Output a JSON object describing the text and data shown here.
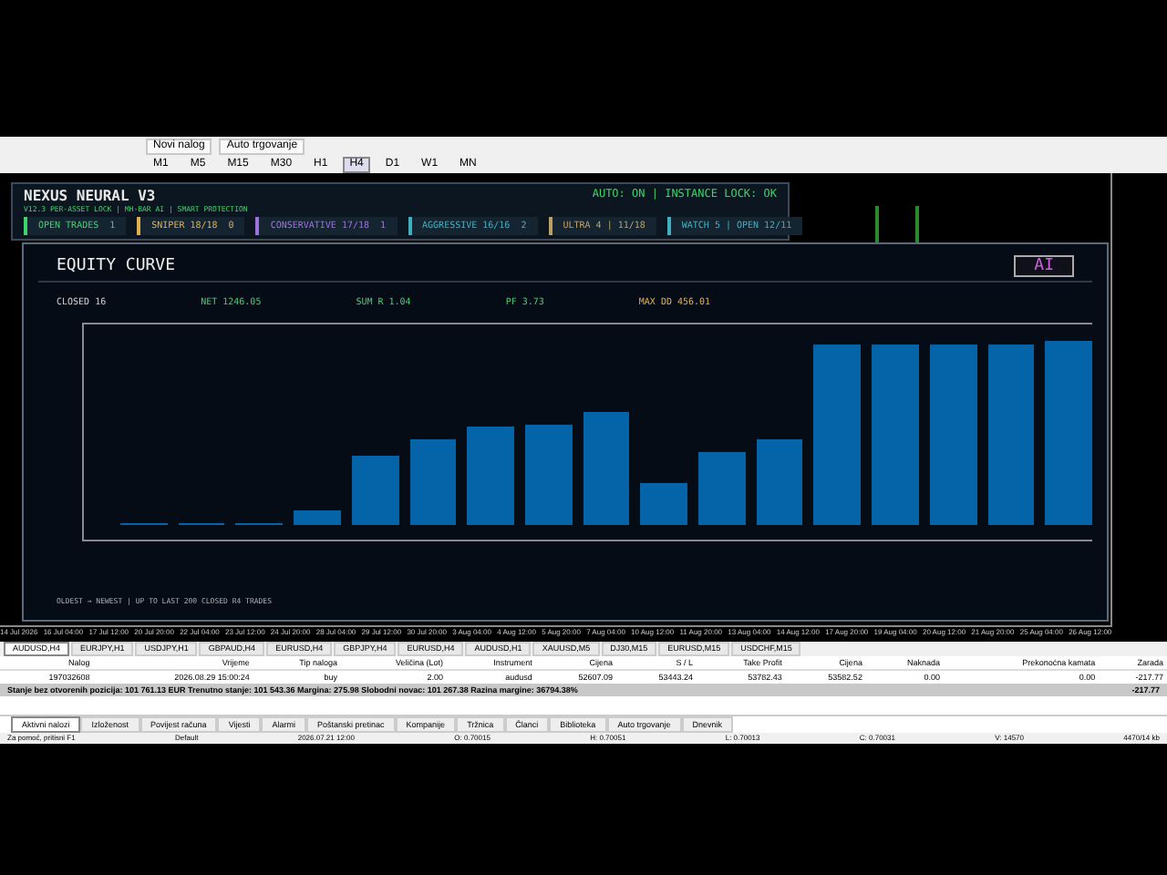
{
  "toolbar": {
    "buttons": [
      {
        "label": "Novi nalog"
      },
      {
        "label": "Auto trgovanje"
      }
    ],
    "timeframes": [
      {
        "label": "M1",
        "selected": false
      },
      {
        "label": "M5",
        "selected": false
      },
      {
        "label": "M15",
        "selected": false
      },
      {
        "label": "M30",
        "selected": false
      },
      {
        "label": "H1",
        "selected": false
      },
      {
        "label": "H4",
        "selected": true
      },
      {
        "label": "D1",
        "selected": false
      },
      {
        "label": "W1",
        "selected": false
      },
      {
        "label": "MN",
        "selected": false
      }
    ]
  },
  "dashboard": {
    "title": "NEXUS NEURAL V3",
    "subtitle": "V12.3 PER-ASSET LOCK | MH-BAR AI | SMART PROTECTION",
    "status": "AUTO: ON | INSTANCE LOCK: OK",
    "chips": [
      {
        "label": "OPEN TRADES",
        "value": "1",
        "color": "#3fd36a"
      },
      {
        "label": "SNIPER 18/18",
        "value": "0",
        "color": "#e0b050"
      },
      {
        "label": "CONSERVATIVE 17/18",
        "value": "1",
        "color": "#a070e0"
      },
      {
        "label": "AGGRESSIVE 16/16",
        "value": "2",
        "color": "#40b0c0"
      },
      {
        "label": "ULTRA 4 | 11/18",
        "color": "#c0a060"
      },
      {
        "label": "WATCH 5 | OPEN 12/11",
        "color": "#40b0c0"
      }
    ]
  },
  "equity": {
    "title": "EQUITY CURVE",
    "ai_button": "AI",
    "stats": [
      {
        "text": "CLOSED 16",
        "color": "#d0d0d0"
      },
      {
        "text": "NET 1246.05",
        "color": "#3fd36a"
      },
      {
        "text": "SUM R 1.04",
        "color": "#3fd36a"
      },
      {
        "text": "PF 3.73",
        "color": "#3fd36a"
      },
      {
        "text": "MAX DD 456.01",
        "color": "#e0b050"
      }
    ],
    "footer": "OLDEST → NEWEST | UP TO LAST 200 CLOSED R4 TRADES"
  },
  "time_axis": [
    "14 Jul 2026",
    "16 Jul 04:00",
    "17 Jul 12:00",
    "20 Jul 20:00",
    "22 Jul 04:00",
    "23 Jul 12:00",
    "24 Jul 20:00",
    "28 Jul 04:00",
    "29 Jul 12:00",
    "30 Jul 20:00",
    "3 Aug 04:00",
    "4 Aug 12:00",
    "5 Aug 20:00",
    "7 Aug 04:00",
    "10 Aug 12:00",
    "11 Aug 20:00",
    "13 Aug 04:00",
    "14 Aug 12:00",
    "17 Aug 20:00",
    "19 Aug 04:00",
    "20 Aug 12:00",
    "21 Aug 20:00",
    "25 Aug 04:00",
    "26 Aug 12:00"
  ],
  "chart_tabs": [
    {
      "label": "AUDUSD,H4",
      "selected": true
    },
    {
      "label": "EURJPY,H1",
      "selected": false
    },
    {
      "label": "USDJPY,H1",
      "selected": false
    },
    {
      "label": "GBPAUD,H4",
      "selected": false
    },
    {
      "label": "EURUSD,H4",
      "selected": false
    },
    {
      "label": "GBPJPY,H4",
      "selected": false
    },
    {
      "label": "EURUSD,H4",
      "selected": false
    },
    {
      "label": "AUDUSD,H1",
      "selected": false
    },
    {
      "label": "XAUUSD,M5",
      "selected": false
    },
    {
      "label": "DJ30,M15",
      "selected": false
    },
    {
      "label": "EURUSD,M15",
      "selected": false
    },
    {
      "label": "USDCHF,M15",
      "selected": false
    }
  ],
  "orders": {
    "columns": [
      "Nalog",
      "Vrijeme",
      "Tip naloga",
      "Veličina (Lot)",
      "Instrument",
      "Cijena",
      "S / L",
      "Take Profit",
      "Cijena",
      "Naknada",
      "Prekonoćna kamata",
      "Zarada"
    ],
    "rows": [
      [
        "197032608",
        "2026.08.29 15:00:24",
        "buy",
        "2.00",
        "audusd",
        "52607.09",
        "53443.24",
        "53782.43",
        "53582.52",
        "0.00",
        "0.00",
        "-217.77"
      ]
    ],
    "summary": "Stanje bez otvorenih pozicija: 101 761.13 EUR  Trenutno stanje: 101 543.36  Margina: 275.98  Slobodni novac: 101 267.38  Razina margine: 36794.38%",
    "summary_total": "-217.77"
  },
  "terminal_tabs": [
    {
      "label": "Aktivni nalozi",
      "selected": true
    },
    {
      "label": "Izloženost",
      "selected": false
    },
    {
      "label": "Povijest računa",
      "selected": false
    },
    {
      "label": "Vijesti",
      "selected": false
    },
    {
      "label": "Alarmi",
      "selected": false
    },
    {
      "label": "Poštanski pretinac",
      "selected": false
    },
    {
      "label": "Kompanije",
      "selected": false
    },
    {
      "label": "Tržnica",
      "selected": false
    },
    {
      "label": "Članci",
      "selected": false
    },
    {
      "label": "Biblioteka",
      "selected": false
    },
    {
      "label": "Auto trgovanje",
      "selected": false
    },
    {
      "label": "Dnevnik",
      "selected": false
    }
  ],
  "status_bar": {
    "help": "Za pomoć, pritisni F1",
    "profile": "Default",
    "time": "2026.07.21 12:00",
    "open": "O: 0.70015",
    "high": "H: 0.70051",
    "low": "L: 0.70013",
    "close": "C: 0.70031",
    "volume": "V: 14570",
    "traffic": "4470/14 kb"
  }
}
